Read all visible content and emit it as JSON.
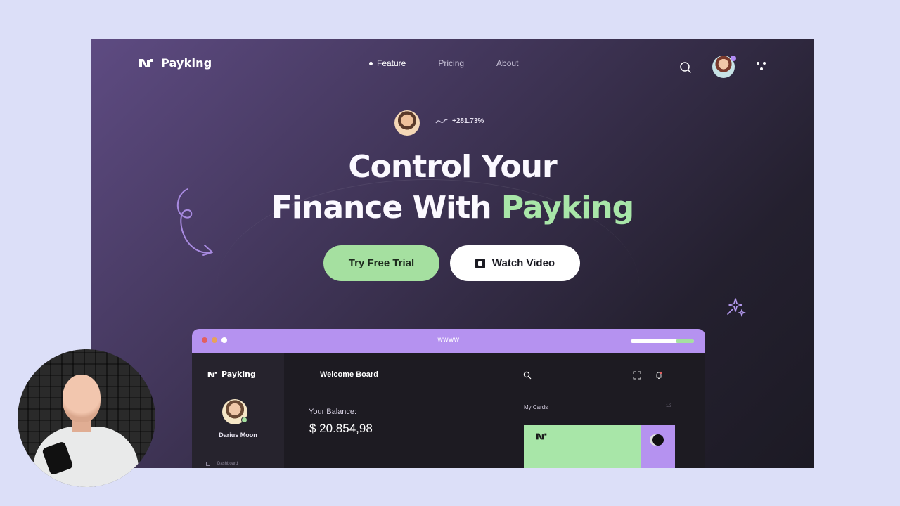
{
  "brand": {
    "name": "Payking"
  },
  "nav": {
    "items": [
      {
        "label": "Feature",
        "active": true
      },
      {
        "label": "Pricing",
        "active": false
      },
      {
        "label": "About",
        "active": false
      }
    ]
  },
  "header": {
    "icons": [
      "search-icon",
      "user-avatar",
      "menu-dots-icon"
    ]
  },
  "hero": {
    "growth": "+281.73%",
    "title_line1": "Control Your",
    "title_line2_prefix": "Finance With ",
    "title_line2_accent": "Payking",
    "primary_cta": "Try Free Trial",
    "secondary_cta": "Watch Video"
  },
  "dashboard": {
    "url": "wwww",
    "brand": "Payking",
    "user_name": "Darius Moon",
    "nav_item": "Dashboard",
    "welcome": "Welcome Board",
    "balance_label": "Your Balance:",
    "balance": "$ 20.854,98",
    "cards_label": "My Cards",
    "cards_count": "1/3"
  },
  "colors": {
    "accent_green": "#a8e6a8",
    "accent_purple": "#b592f0",
    "background": "#dcdff8"
  }
}
